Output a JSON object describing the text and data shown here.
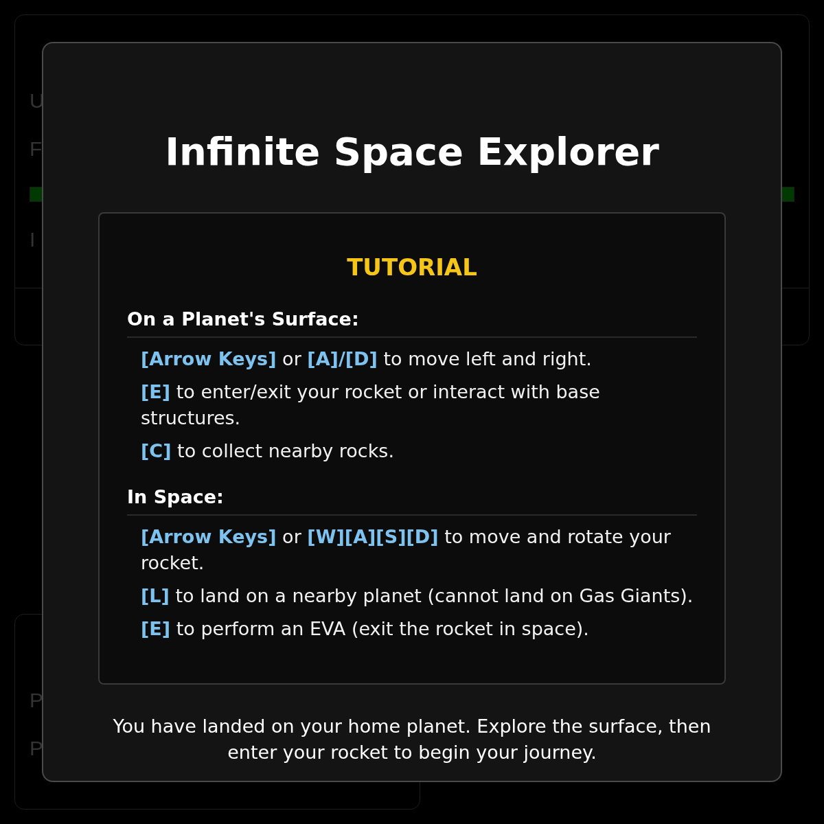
{
  "background_panels": [
    {
      "letters": [
        "U",
        "F"
      ],
      "bar": {
        "level": 1
      },
      "lower_letters": [
        "I"
      ]
    },
    {
      "letters": [
        "P",
        "P"
      ]
    }
  ],
  "modal": {
    "title": "Infinite Space Explorer",
    "tutorial": {
      "heading": "TUTORIAL",
      "sections": [
        {
          "title": "On a Planet's Surface:",
          "items": [
            "**[Arrow Keys]** or **[A]/[D]** to move left and right.",
            "**[E]** to enter/exit your rocket or interact with base structures.",
            "**[C]** to collect nearby rocks."
          ]
        },
        {
          "title": "In Space:",
          "items": [
            "**[Arrow Keys]** or **[W][A][S][D]** to move and rotate your rocket.",
            "**[L]** to land on a nearby planet (cannot land on Gas Giants).",
            "**[E]** to perform an EVA (exit the rocket in space)."
          ]
        }
      ]
    },
    "message": "You have landed on your home planet. Explore the surface, then enter your rocket to begin your journey."
  }
}
